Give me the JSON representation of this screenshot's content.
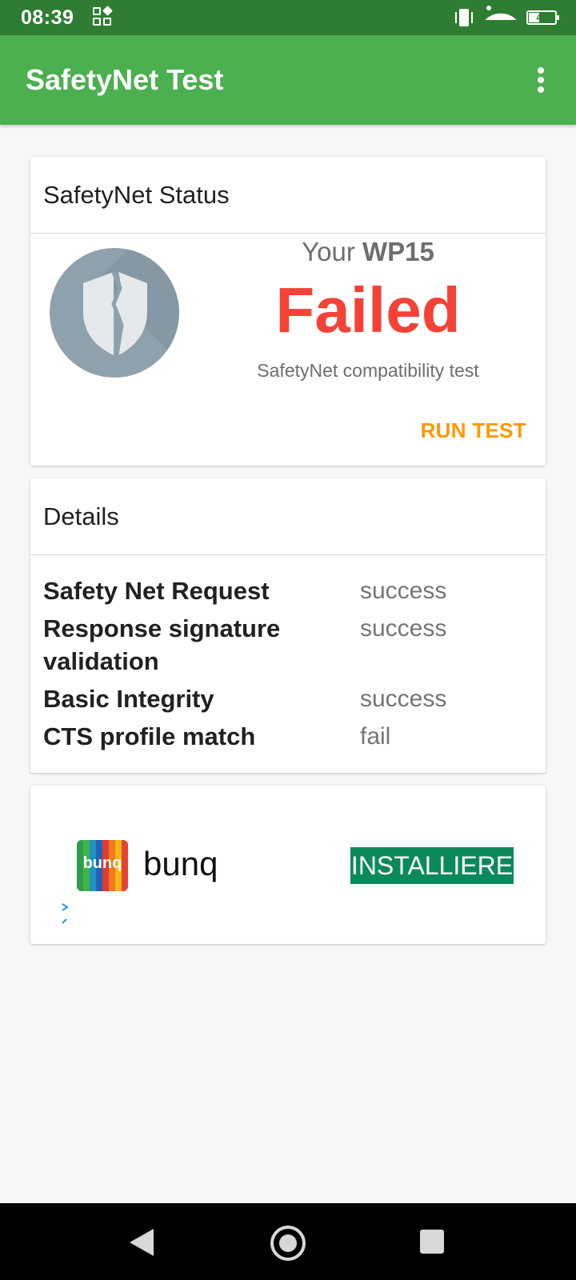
{
  "status_bar": {
    "time": "08:39",
    "battery_level": "43",
    "battery_fraction": 0.43,
    "icons": [
      "screen-layout-icon",
      "vibrate-icon",
      "wifi-icon",
      "battery-icon"
    ]
  },
  "app_bar": {
    "title": "SafetyNet Test",
    "menu_icon": "overflow-menu-icon"
  },
  "status_card": {
    "title": "SafetyNet Status",
    "your_prefix": "Your",
    "device": "WP15",
    "result": "Failed",
    "subtitle": "SafetyNet compatibility test",
    "run_test_label": "RUN TEST",
    "shield_icon": "broken-shield-icon",
    "result_color": "#f44336",
    "accent_color": "#ff9800"
  },
  "details_card": {
    "title": "Details",
    "rows": [
      {
        "key": "Safety Net Request",
        "value": "success"
      },
      {
        "key": "Response signature validation",
        "value": "success"
      },
      {
        "key": "Basic Integrity",
        "value": "success"
      },
      {
        "key": "CTS profile match",
        "value": "fail"
      }
    ]
  },
  "ad_card": {
    "app_name": "bunq",
    "logo_text": "bunq",
    "install_label": "INSTALLIERE",
    "install_color": "#0a8a5b"
  },
  "colors": {
    "status_bar": "#2f7d32",
    "app_bar": "#4caf50"
  }
}
